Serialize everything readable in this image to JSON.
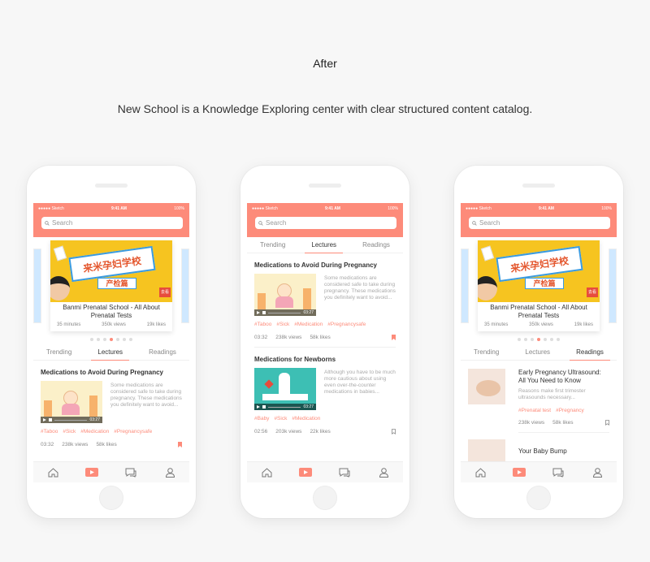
{
  "heading": "After",
  "subheading": "New School is a Knowledge Exploring center with clear structured content catalog.",
  "colors": {
    "accent": "#fd8b7a",
    "tag": "#fd8b7a",
    "muted": "#888888"
  },
  "status": {
    "carrier": "●●●●● Sketch",
    "time": "9:41 AM",
    "battery": "100%"
  },
  "search": {
    "placeholder": "Search"
  },
  "banner": {
    "art_title": "来米孕妇学校",
    "art_subtitle": "产检篇",
    "stamp": "去看",
    "title": "Banmi Prenatal School - All About Prenatal Tests",
    "minutes": "35 minutes",
    "views": "350k views",
    "likes": "19k likes"
  },
  "tabs": [
    "Trending",
    "Lectures",
    "Readings"
  ],
  "lectures": [
    {
      "title": "Medications to Avoid During Pregnancy",
      "duration_shown": "03:27",
      "description": "Some medications are considered safe to take during pregnancy. These medications you definitely want to avoid...",
      "tags": [
        "#Taboo",
        "#Sick",
        "#Medication",
        "#Pregnancysafe"
      ],
      "time": "03:32",
      "views": "238k views",
      "likes": "58k likes"
    },
    {
      "title": "Medications for Newborns",
      "duration_shown": "03:27",
      "description": "Although you have to be much more cautious about using even over-the-counter medications in babies...",
      "tags": [
        "#Baby",
        "#Sick",
        "#Medication"
      ],
      "time": "02:56",
      "views": "203k views",
      "likes": "22k likes"
    }
  ],
  "readings": [
    {
      "title": "Early Pregnancy Ultrasound: All You Need to Know",
      "description": "Reasons make first trimester ultrasounds necessary...",
      "tags": [
        "#Prenatal test",
        "#Pregnancy"
      ],
      "views": "238k views",
      "likes": "58k likes"
    },
    {
      "title": "Your Baby Bump"
    }
  ],
  "tabbar": {
    "icons": [
      "home-icon",
      "play-icon",
      "chat-icon",
      "profile-icon"
    ]
  }
}
